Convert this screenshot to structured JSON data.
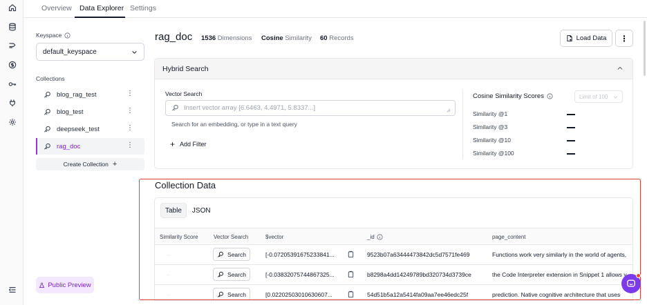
{
  "tabs": [
    {
      "label": "Overview",
      "active": false
    },
    {
      "label": "Data Explorer",
      "active": true
    },
    {
      "label": "Settings",
      "active": false
    }
  ],
  "rail_icons": [
    "home-icon",
    "database-icon",
    "route-icon",
    "dollar-icon",
    "key-icon",
    "plug-icon",
    "gear-icon",
    "collapse-icon"
  ],
  "sidebar": {
    "keyspace_label": "Keyspace",
    "keyspace_value": "default_keyspace",
    "collections_label": "Collections",
    "collections": [
      {
        "label": "blog_rag_test",
        "selected": false
      },
      {
        "label": "blog_test",
        "selected": false
      },
      {
        "label": "deepseek_test",
        "selected": false
      },
      {
        "label": "rag_doc",
        "selected": true
      }
    ],
    "create_label": "Create Collection",
    "public_preview_label": "Public Preview"
  },
  "header": {
    "title": "rag_doc",
    "dimensions_value": "1536",
    "dimensions_label": "Dimensions",
    "metric_value": "Cosine",
    "metric_label": "Similarity",
    "records_value": "60",
    "records_label": "Records",
    "load_data_label": "Load Data"
  },
  "hybrid_search": {
    "title": "Hybrid Search",
    "vector_label": "Vector Search",
    "vector_placeholder": "Insert vector array [6.6463, 4.4971, 5.8337...]",
    "help_text": "Search for an embedding, or type in a text query",
    "add_filter_label": "Add Filter",
    "scores_title": "Cosine Similarity Scores",
    "limit_label": "Limit of 100",
    "scores": [
      {
        "label": "Similarity @1",
        "value": "—"
      },
      {
        "label": "Similarity @3",
        "value": "—"
      },
      {
        "label": "Similarity @10",
        "value": "—"
      },
      {
        "label": "Similarity @100",
        "value": "—"
      }
    ]
  },
  "collection_data": {
    "title": "Collection Data",
    "views": [
      {
        "label": "Table",
        "active": true
      },
      {
        "label": "JSON",
        "active": false
      }
    ],
    "columns": [
      "Similarity Score",
      "Vector Search",
      "$vector",
      "_id",
      "page_content"
    ],
    "search_label": "Search",
    "rows": [
      {
        "score": "-",
        "vector": "[-0.07205391675233841...",
        "id": "9523b07a63444473842dc5d7571fe469",
        "content": "Functions work very similarly in the world of agents,"
      },
      {
        "score": "-",
        "vector": "[-0.03832075744867325...",
        "id": "b8298a4dd14249789bd320734d3739ce",
        "content": "the Code Interpreter extension in Snippet 1 allows y"
      },
      {
        "score": "-",
        "vector": "[0.02202503010630607...",
        "id": "54d51b5a12a5414fa09aa7ee46edc25f",
        "content": "prediction. Native cognitive architecture that uses"
      }
    ]
  },
  "colors": {
    "accent": "#7e22ce",
    "highlight_border": "#dc3d2e"
  }
}
